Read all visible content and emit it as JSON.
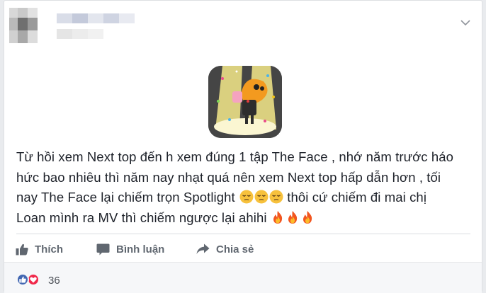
{
  "post": {
    "text_lines": [
      "Từ hồi xem Next top đến h xem đúng 1 tập The Face , nhớ năm trước háo",
      "hức bao nhiêu thì năm nay nhạt quá nên xem Next top hấp dẫn hơn , tối",
      "nay The Face lại chiếm trọn Spotlight ",
      " thôi cứ chiếm đi mai chị",
      "Loan mình ra MV thì chiếm ngược lại ahihi "
    ],
    "emojis": [
      "unamused-face-emoji",
      "fire-emoji"
    ]
  },
  "actions": {
    "like_label": "Thích",
    "comment_label": "Bình luận",
    "share_label": "Chia sẻ"
  },
  "reactions": {
    "types": [
      "like",
      "love"
    ],
    "count": "36"
  },
  "icons": {
    "header_menu": "chevron-down-icon",
    "like": "thumbs-up-icon",
    "comment": "speech-bubble-icon",
    "share": "share-arrow-icon"
  },
  "colors": {
    "like_blue": "#4267b2",
    "love_red": "#f0284a",
    "action_gray": "#606770"
  }
}
